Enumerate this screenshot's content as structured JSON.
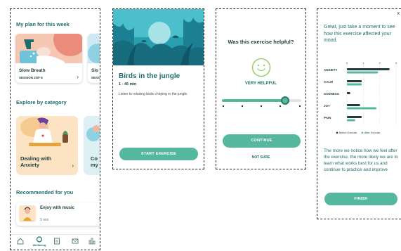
{
  "home": {
    "plan_title": "My plan for this week",
    "plan_card": {
      "title": "Slow Breath",
      "session_label": "SESSION 2OF 5",
      "partial_title": "Slo",
      "partial_session": "SESS"
    },
    "category_title": "Explore by category",
    "category_card": {
      "title": "Dealing with Anxiety",
      "partial": "Co my"
    },
    "recommended_title": "Recommended for you",
    "recommended_card": {
      "title": "Enjoy with music",
      "duration": "3 min"
    },
    "tabs": {
      "wellbeing_label": "Wellbeing"
    }
  },
  "exercise": {
    "title": "Birds in the jungle",
    "meta": "1 - 45 min",
    "description": "Listen to relaxing birds chirping in the jungle.",
    "start_label": "START EXERCISE"
  },
  "feedback": {
    "question": "Was this exercise helpful?",
    "rating_label": "VERY HELPFUL",
    "slider_level": 0.8,
    "continue_label": "CONTINUE",
    "not_sure_label": "NOT SURE"
  },
  "mood": {
    "intro": "Great, just take a moment to see how this exercise affected your mood.",
    "close_label": "x",
    "chart_data": {
      "type": "bar",
      "orientation": "horizontal",
      "categories": [
        "ANXIETY",
        "CALM",
        "SADNESS",
        "JOY",
        "PAIN"
      ],
      "x_ticks": [
        "0",
        "1",
        "2",
        "3"
      ],
      "xlim": [
        0,
        3
      ],
      "series": [
        {
          "name": "Before Exercise",
          "color": "#1f3b3a",
          "values": [
            2.6,
            0.9,
            0.2,
            0.8,
            0.9
          ]
        },
        {
          "name": "After Exercise",
          "color": "#56b79f",
          "values": [
            1.9,
            0.9,
            0.0,
            1.8,
            0.5
          ]
        }
      ],
      "legend_position": "bottom",
      "grid": true
    },
    "summary": "The more we notice how we feel after the exercise, the more likely we are to learn what works best for us and continue to practice and improve",
    "finish_label": "FINISH"
  }
}
